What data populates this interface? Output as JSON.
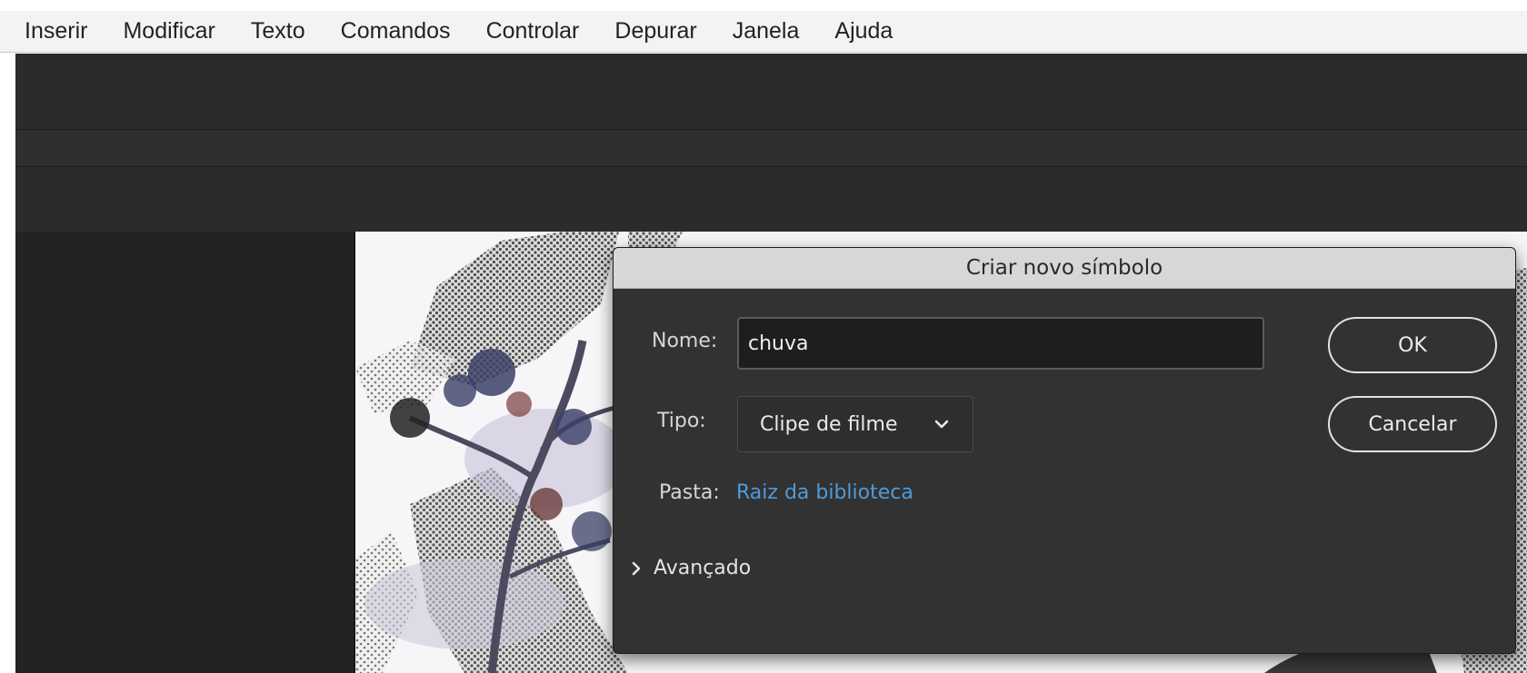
{
  "menu": [
    "Inserir",
    "Modificar",
    "Texto",
    "Comandos",
    "Controlar",
    "Depurar",
    "Janela",
    "Ajuda"
  ],
  "dialog": {
    "title": "Criar novo símbolo",
    "name_label": "Nome:",
    "name_value": "chuva",
    "type_label": "Tipo:",
    "type_value": "Clipe de filme",
    "folder_label": "Pasta:",
    "folder_value": "Raiz da biblioteca",
    "advanced_label": "Avançado",
    "ok_label": "OK",
    "cancel_label": "Cancelar"
  },
  "icons": {
    "type_dropdown": "chevron-down-icon",
    "advanced_toggle": "chevron-right-icon"
  },
  "colors": {
    "link": "#4d9bdc",
    "dialog_bg": "#323232",
    "title_bar": "#d7d7d7"
  }
}
